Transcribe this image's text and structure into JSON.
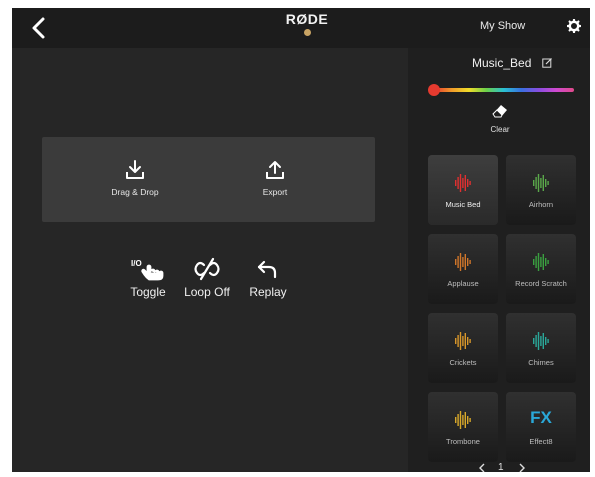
{
  "header": {
    "logo": "RØDE",
    "show_name": "My Show"
  },
  "bank": {
    "name": "Music_Bed",
    "clear_label": "Clear",
    "page": "1"
  },
  "pads": [
    {
      "label": "Music Bed",
      "color": "#e03030",
      "icon": "waveform-icon"
    },
    {
      "label": "Airhorn",
      "color": "#5aa84a",
      "icon": "waveform-icon"
    },
    {
      "label": "Applause",
      "color": "#d0762a",
      "icon": "waveform-icon"
    },
    {
      "label": "Record Scratch",
      "color": "#3aa040",
      "icon": "waveform-icon"
    },
    {
      "label": "Crickets",
      "color": "#d8962a",
      "icon": "waveform-icon"
    },
    {
      "label": "Chimes",
      "color": "#2aa89a",
      "icon": "waveform-icon"
    },
    {
      "label": "Trombone",
      "color": "#d8a82a",
      "icon": "waveform-icon"
    },
    {
      "label": "Effect8",
      "color": "#2aa8d8",
      "icon": "fx-text",
      "text": "FX"
    }
  ],
  "actions": {
    "drag_drop": "Drag & Drop",
    "export": "Export"
  },
  "controls": {
    "toggle_badge": "I/O",
    "toggle": "Toggle",
    "loop": "Loop Off",
    "replay": "Replay"
  },
  "colors": {
    "accent": "#c9a464",
    "background": "#262626",
    "panel": "#1f1f1f"
  }
}
